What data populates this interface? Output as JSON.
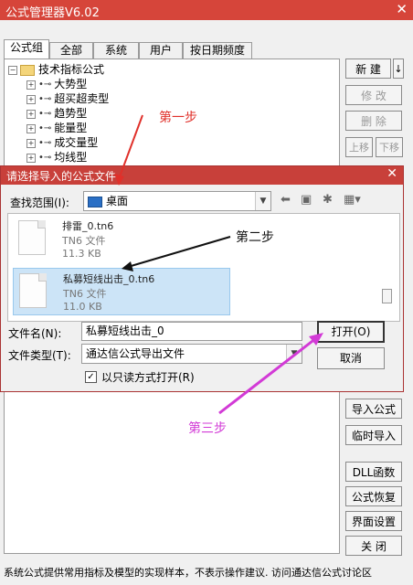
{
  "window": {
    "title": "公式管理器V6.02",
    "close_glyph": "✕"
  },
  "tabs": [
    "公式组",
    "全部",
    "系统",
    "用户",
    "按日期频度"
  ],
  "tree": {
    "root": "技术指标公式",
    "items": [
      "大势型",
      "超买超卖型",
      "趋势型",
      "能量型",
      "成交量型",
      "均线型"
    ]
  },
  "side_buttons": {
    "new": "新 建",
    "new_arrow": "↓",
    "modify": "修 改",
    "delete": "删 除",
    "move_up": "上移",
    "move_down": "下移",
    "import": "导入公式",
    "temp_import": "临时导入",
    "dll": "DLL函数",
    "restore": "公式恢复",
    "ui_settings": "界面设置",
    "close": "关 闭"
  },
  "status_text": "系统公式提供常用指标及模型的实现样本，不表示操作建议.  访问通达信公式讨论区",
  "dialog": {
    "title": "请选择导入的公式文件",
    "close_glyph": "✕",
    "lookin_label": "查找范围(I):",
    "lookin_value": "桌面",
    "files": [
      {
        "name": "排雷_0.tn6",
        "type": "TN6 文件",
        "size": "11.3 KB",
        "selected": false
      },
      {
        "name": "私募短线出击_0.tn6",
        "type": "TN6 文件",
        "size": "11.0 KB",
        "selected": true
      }
    ],
    "filename_label": "文件名(N):",
    "filename_value": "私募短线出击_0",
    "filetype_label": "文件类型(T):",
    "filetype_value": "通达信公式导出文件",
    "open_button": "打开(O)",
    "cancel_button": "取消",
    "readonly_label": "以只读方式打开(R)",
    "readonly_checked": true
  },
  "annotations": {
    "step1": "第一步",
    "step2": "第二步",
    "step3": "第三步",
    "colors": {
      "step1": "#e0302a",
      "step2": "#111111",
      "step3": "#d23ad6"
    }
  }
}
